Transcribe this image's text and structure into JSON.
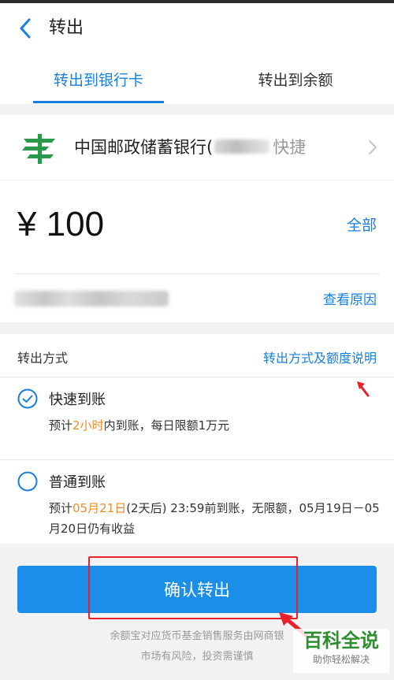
{
  "header": {
    "title": "转出"
  },
  "tabs": [
    {
      "label": "转出到银行卡",
      "active": true
    },
    {
      "label": "转出到余额",
      "active": false
    }
  ],
  "bank": {
    "name": "中国邮政储蓄银行(",
    "suffix": "快捷"
  },
  "amount": {
    "value": "¥ 100",
    "all_label": "全部",
    "reason_label": "查看原因"
  },
  "method": {
    "label": "转出方式",
    "info_link": "转出方式及额度说明",
    "options": [
      {
        "title": "快速到账",
        "selected": true,
        "desc_pre": "预计",
        "desc_hl": "2小时",
        "desc_post": "内到账，每日限额1万元"
      },
      {
        "title": "普通到账",
        "selected": false,
        "desc_pre": "预计",
        "desc_hl": "05月21日",
        "desc_post": "(2天后) 23:59前到账，无限额，05月19日－05月20日仍有收益"
      }
    ]
  },
  "confirm_button": "确认转出",
  "disclaimer": {
    "line1": "余额宝对应货币基金销售服务由网商银",
    "line2": "市场有风险，投资需谨慎"
  },
  "watermark": {
    "main": "百科全说",
    "sub": "助你轻松解决"
  },
  "colors": {
    "accent": "#1a7fdb",
    "button": "#1a8ee8",
    "highlight": "#f08c2a",
    "annotation": "#e8202a",
    "bank_logo": "#2a9a4a"
  }
}
